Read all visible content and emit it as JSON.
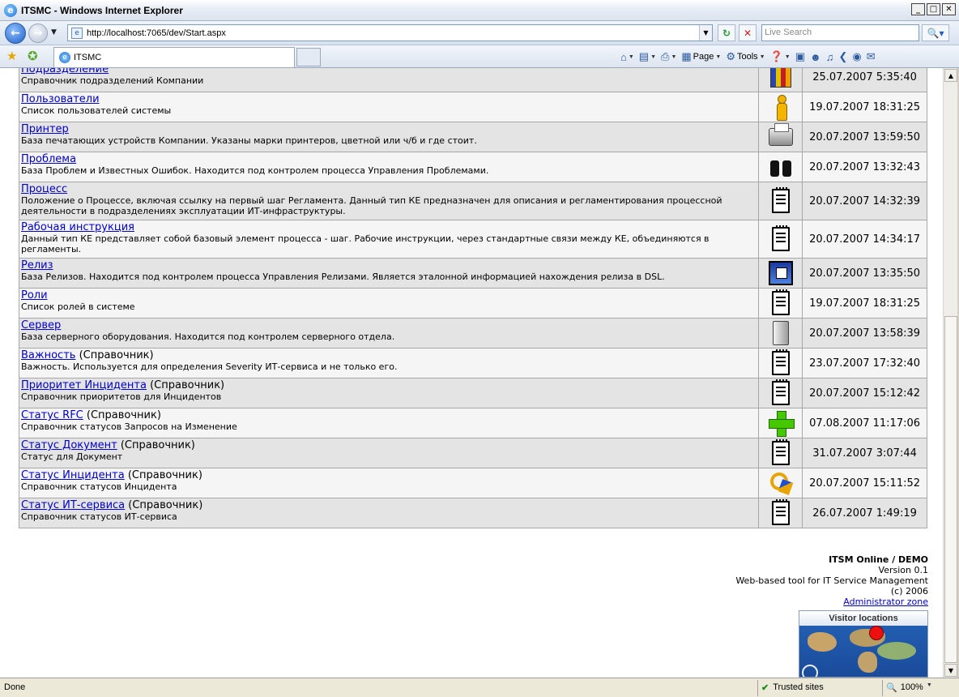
{
  "window": {
    "title": "ITSMC - Windows Internet Explorer",
    "minimize": "_",
    "maximize": "□",
    "close": "✕"
  },
  "address": {
    "url": "http://localhost:7065/dev/Start.aspx",
    "search_placeholder": "Live Search"
  },
  "tab": {
    "label": "ITSMC"
  },
  "commands": {
    "page": "Page",
    "tools": "Tools"
  },
  "rows": [
    {
      "link": "Подразделение",
      "suffix": "",
      "desc": "Справочник подразделений Компании",
      "icon": "books-icon",
      "date": "25.07.2007 5:35:40"
    },
    {
      "link": "Пользователи",
      "suffix": "",
      "desc": "Список пользователей системы",
      "icon": "person-icon",
      "date": "19.07.2007 18:31:25"
    },
    {
      "link": "Принтер",
      "suffix": "",
      "desc": "База печатающих устройств Компании. Указаны марки принтеров, цветной или ч/б и где стоит.",
      "icon": "printer-icon",
      "date": "20.07.2007 13:59:50"
    },
    {
      "link": "Проблема",
      "suffix": "",
      "desc": "База Проблем и Известных Ошибок. Находится под контролем процесса Управления Проблемами.",
      "icon": "binoculars-icon",
      "date": "20.07.2007 13:32:43"
    },
    {
      "link": "Процесс",
      "suffix": "",
      "desc": "Положение о Процессе, включая ссылку на первый шаг Регламента. Данный тип КЕ предназначен для описания и регламентирования процессной деятельности в подразделениях эксплуатации ИТ-инфраструктуры.",
      "icon": "document-icon",
      "date": "20.07.2007 14:32:39"
    },
    {
      "link": "Рабочая инструкция",
      "suffix": "",
      "desc": "Данный тип КЕ представляет собой базовый элемент процесса - шаг. Рабочие инструкции, через стандартные связи между КЕ, объединяются в регламенты.",
      "icon": "document-icon",
      "date": "20.07.2007 14:34:17"
    },
    {
      "link": "Релиз",
      "suffix": "",
      "desc": "База Релизов. Находится под контролем процесса Управления Релизами. Является эталонной информацией нахождения релиза в DSL.",
      "icon": "release-icon",
      "date": "20.07.2007 13:35:50"
    },
    {
      "link": "Роли",
      "suffix": "",
      "desc": "Список ролей в системе",
      "icon": "document-icon",
      "date": "19.07.2007 18:31:25"
    },
    {
      "link": "Сервер",
      "suffix": "",
      "desc": "База серверного оборудования. Находится под контролем серверного отдела.",
      "icon": "server-icon",
      "date": "20.07.2007 13:58:39"
    },
    {
      "link": "Важность",
      "suffix": " (Справочник)",
      "desc": "Важность. Используется для определения Severity ИТ-сервиса и не только его.",
      "icon": "document-icon",
      "date": "23.07.2007 17:32:40"
    },
    {
      "link": "Приоритет Инцидента",
      "suffix": " (Справочник)",
      "desc": "Справочник приоритетов для Инцидентов",
      "icon": "document-icon",
      "date": "20.07.2007 15:12:42"
    },
    {
      "link": "Статус RFC",
      "suffix": " (Справочник)",
      "desc": "Справочник статусов Запросов на Изменение",
      "icon": "plus-icon",
      "date": "07.08.2007 11:17:06"
    },
    {
      "link": "Статус Документ",
      "suffix": " (Справочник)",
      "desc": "Статус для Документ",
      "icon": "document-icon",
      "date": "31.07.2007 3:07:44"
    },
    {
      "link": "Статус Инцидента",
      "suffix": " (Справочник)",
      "desc": "Справочник статусов Инцидента",
      "icon": "keys-icon",
      "date": "20.07.2007 15:11:52"
    },
    {
      "link": "Статус ИТ-сервиса",
      "suffix": " (Справочник)",
      "desc": "Справочник статусов ИТ-сервиса",
      "icon": "document-icon",
      "date": "26.07.2007 1:49:19"
    }
  ],
  "footer": {
    "brand": "ITSM Online / DEMO",
    "version": "Version 0.1",
    "tagline": "Web-based tool for IT Service Management",
    "copyright": "(c) 2006",
    "admin_link": "Administrator zone"
  },
  "visitor_widget": {
    "title": "Visitor locations"
  },
  "status": {
    "left": "Done",
    "zone": "Trusted sites",
    "zoom": "100%"
  }
}
